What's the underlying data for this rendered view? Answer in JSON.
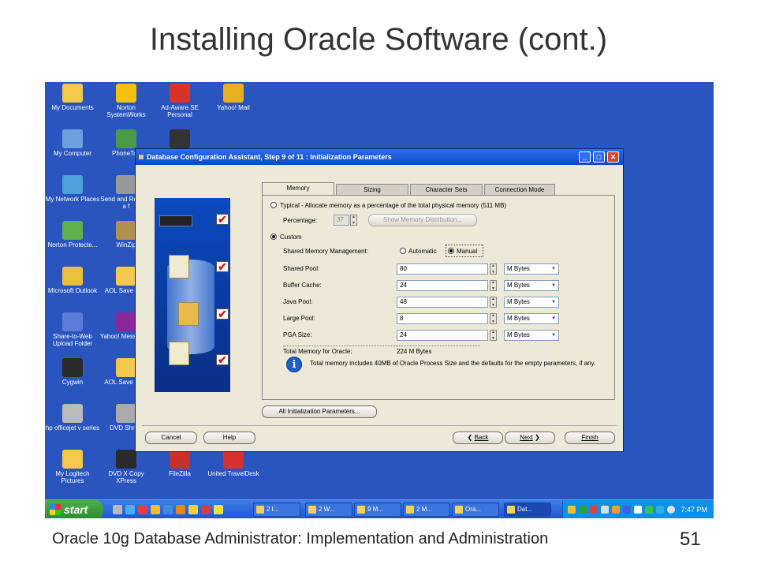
{
  "slide": {
    "title": "Installing Oracle Software (cont.)",
    "footer": "Oracle 10g Database Administrator: Implementation and Administration",
    "page_number": "51"
  },
  "desktop_icons": [
    {
      "label": "My Documents",
      "icon": "folder-docs-icon",
      "color": "#f2c94c"
    },
    {
      "label": "Norton SystemWorks",
      "icon": "norton-icon",
      "color": "#f4c10b"
    },
    {
      "label": "Ad-Aware SE Personal",
      "icon": "adaware-icon",
      "color": "#d8322a"
    },
    {
      "label": "Yahoo! Mail",
      "icon": "mail-icon",
      "color": "#e8b020"
    },
    {
      "label": "My Computer",
      "icon": "computer-icon",
      "color": "#6ea0e0"
    },
    {
      "label": "PhoneToo",
      "icon": "phone-icon",
      "color": "#4a9a4a"
    },
    {
      "label": "",
      "icon": "dvd-icon",
      "color": "#333333"
    },
    {
      "label": "My Network Places",
      "icon": "network-icon",
      "color": "#4f9fd8"
    },
    {
      "label": "Send and Receive a f",
      "icon": "send-icon",
      "color": "#999999"
    },
    {
      "label": "Norton Protecte...",
      "icon": "recycle-icon",
      "color": "#5fb04f"
    },
    {
      "label": "WinZip",
      "icon": "winzip-icon",
      "color": "#b09050"
    },
    {
      "label": "Microsoft Outlook",
      "icon": "outlook-icon",
      "color": "#e8c040"
    },
    {
      "label": "AOL Save PFC",
      "icon": "folder-icon",
      "color": "#f2c94c"
    },
    {
      "label": "Share-to-Web Upload Folder",
      "icon": "share-icon",
      "color": "#5b7bd8"
    },
    {
      "label": "Yahoo! Messenger",
      "icon": "messenger-icon",
      "color": "#8a2a9a"
    },
    {
      "label": "Cygwin",
      "icon": "cygwin-icon",
      "color": "#2a2a2a"
    },
    {
      "label": "AOL Save Files",
      "icon": "folder-icon",
      "color": "#f2c94c"
    },
    {
      "label": "hp officejet v series",
      "icon": "printer-icon",
      "color": "#bbbbbb"
    },
    {
      "label": "DVD Shrink",
      "icon": "dvdshrink-icon",
      "color": "#aaaaaa"
    },
    {
      "label": "My Logitech Pictures",
      "icon": "pictures-icon",
      "color": "#f2c94c"
    },
    {
      "label": "DVD X Copy XPress",
      "icon": "dvdx-icon",
      "color": "#2a2a2a"
    },
    {
      "label": "FileZilla",
      "icon": "filezilla-icon",
      "color": "#c8302a"
    },
    {
      "label": "United TravelDesk",
      "icon": "travel-icon",
      "color": "#d83030"
    }
  ],
  "taskbar": {
    "start_label": "start",
    "tasks": [
      "2 I...",
      "2 W...",
      "9 M...",
      "2 M...",
      "Ora...",
      "Dat..."
    ],
    "clock": "7:47 PM"
  },
  "window": {
    "title": "Database Configuration Assistant, Step 9 of 11 : Initialization Parameters",
    "controls": {
      "minimize": "_",
      "maximize": "□",
      "close": "✕"
    },
    "tabs": [
      "Memory",
      "Sizing",
      "Character Sets",
      "Connection Mode"
    ],
    "memory": {
      "typical_label": "Typical - Allocate memory as a percentage of the total physical memory (511 MB)",
      "percentage_label": "Percentage:",
      "percentage_value": "37",
      "show_distribution_label": "Show Memory Distribution...",
      "custom_label": "Custom",
      "shared_mgmt_label": "Shared Memory Management:",
      "automatic_label": "Automatic",
      "manual_label": "Manual",
      "pools": [
        {
          "label": "Shared Pool:",
          "value": "80",
          "unit": "M Bytes"
        },
        {
          "label": "Buffer Cache:",
          "value": "24",
          "unit": "M Bytes"
        },
        {
          "label": "Java Pool:",
          "value": "48",
          "unit": "M Bytes"
        },
        {
          "label": "Large Pool:",
          "value": "8",
          "unit": "M Bytes"
        },
        {
          "label": "PGA Size:",
          "value": "24",
          "unit": "M Bytes"
        }
      ],
      "total_label": "Total Memory for Oracle:",
      "total_value": "224 M Bytes",
      "info_text": "Total memory includes 40MB of Oracle Process Size and the defaults for the empty parameters, if any."
    },
    "all_params_label": "All Initialization Parameters...",
    "buttons": {
      "cancel": "Cancel",
      "help": "Help",
      "back": "Back",
      "next": "Next",
      "finish": "Finish"
    }
  }
}
